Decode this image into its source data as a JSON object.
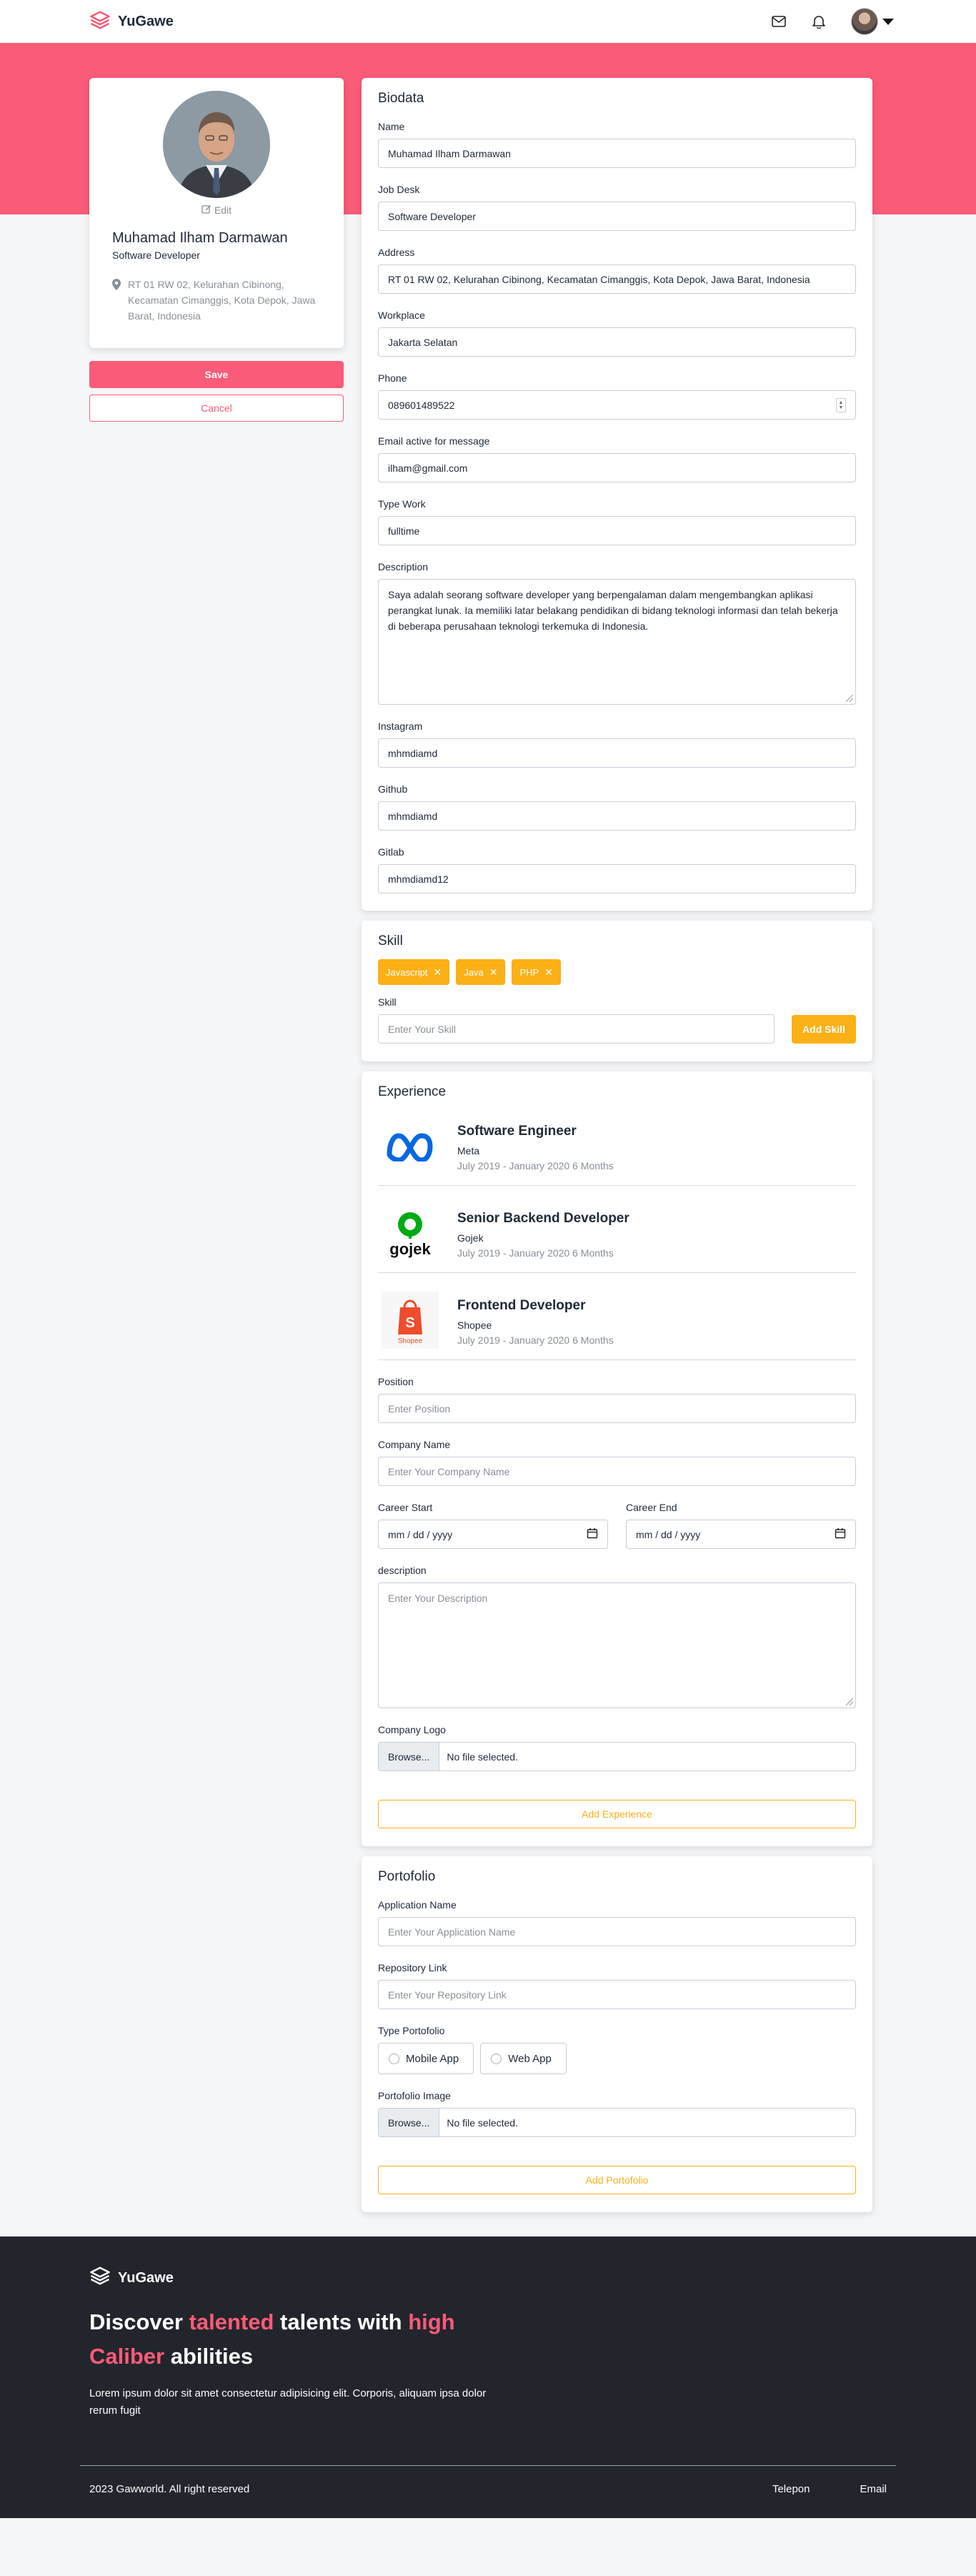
{
  "navbar": {
    "brand": "YuGawe"
  },
  "colors": {
    "primary": "#fa5b78",
    "accent": "#fbb016",
    "footer_bg": "#22252c"
  },
  "profile": {
    "edit_label": "Edit",
    "name": "Muhamad Ilham Darmawan",
    "job": "Software Developer",
    "location": "RT 01 RW 02, Kelurahan Cibinong, Kecamatan Cimanggis, Kota Depok, Jawa Barat, Indonesia",
    "save_label": "Save",
    "cancel_label": "Cancel"
  },
  "biodata": {
    "title": "Biodata",
    "fields": {
      "name": {
        "label": "Name",
        "value": "Muhamad Ilham Darmawan"
      },
      "job_desk": {
        "label": "Job Desk",
        "value": "Software Developer"
      },
      "address": {
        "label": "Address",
        "value": "RT 01 RW 02, Kelurahan Cibinong, Kecamatan Cimanggis, Kota Depok, Jawa Barat, Indonesia"
      },
      "workplace": {
        "label": "Workplace",
        "value": "Jakarta Selatan"
      },
      "phone": {
        "label": "Phone",
        "value": "089601489522"
      },
      "email": {
        "label": "Email active for message",
        "value": "ilham@gmail.com"
      },
      "type_work": {
        "label": "Type Work",
        "value": "fulltime"
      },
      "description": {
        "label": "Description",
        "value": "Saya adalah seorang software developer yang berpengalaman dalam mengembangkan aplikasi perangkat lunak. Ia memiliki latar belakang pendidikan di bidang teknologi informasi dan telah bekerja di beberapa perusahaan teknologi terkemuka di Indonesia."
      },
      "instagram": {
        "label": "Instagram",
        "value": "mhmdiamd"
      },
      "github": {
        "label": "Github",
        "value": "mhmdiamd"
      },
      "gitlab": {
        "label": "Gitlab",
        "value": "mhmdiamd12"
      }
    }
  },
  "skill": {
    "title": "Skill",
    "tags": [
      "Javascript",
      "Java",
      "PHP"
    ],
    "input_label": "Skill",
    "input_placeholder": "Enter Your Skill",
    "add_label": "Add Skill"
  },
  "experience": {
    "title": "Experience",
    "items": [
      {
        "position": "Software Engineer",
        "company": "Meta",
        "date": "July 2019 - January 2020  6 Months",
        "logo": "meta-logo"
      },
      {
        "position": "Senior Backend Developer",
        "company": "Gojek",
        "date": "July 2019 - January 2020  6 Months",
        "logo": "gojek-logo"
      },
      {
        "position": "Frontend Developer",
        "company": "Shopee",
        "date": "July 2019 - January 2020  6 Months",
        "logo": "shopee-logo"
      }
    ],
    "form": {
      "position_label": "Position",
      "position_placeholder": "Enter Position",
      "company_label": "Company Name",
      "company_placeholder": "Enter Your Company Name",
      "start_label": "Career Start",
      "end_label": "Career End",
      "date_placeholder": "mm / dd / yyyy",
      "description_label": "description",
      "description_placeholder": "Enter Your Description",
      "logo_label": "Company Logo",
      "browse_label": "Browse...",
      "no_file": "No file selected.",
      "add_label": "Add Experience"
    }
  },
  "portfolio": {
    "title": "Portofolio",
    "app_name_label": "Application Name",
    "app_name_placeholder": "Enter Your Application Name",
    "repo_label": "Repository Link",
    "repo_placeholder": "Enter Your Repository Link",
    "type_label": "Type Portofolio",
    "type_options": [
      "Mobile App",
      "Web App"
    ],
    "image_label": "Portofolio Image",
    "browse_label": "Browse...",
    "no_file": "No file selected.",
    "add_label": "Add Portofolio"
  },
  "footer": {
    "brand": "YuGawe",
    "headline_1": "Discover ",
    "headline_hl_1": "talented",
    "headline_2": " talents with ",
    "headline_hl_2": "high Caliber",
    "headline_3": " abilities",
    "description": "Lorem ipsum dolor sit amet consectetur adipisicing elit. Corporis, aliquam ipsa dolor rerum fugit",
    "copyright": "2023 Gawworld. All right reserved",
    "links": [
      "Telepon",
      "Email"
    ]
  }
}
